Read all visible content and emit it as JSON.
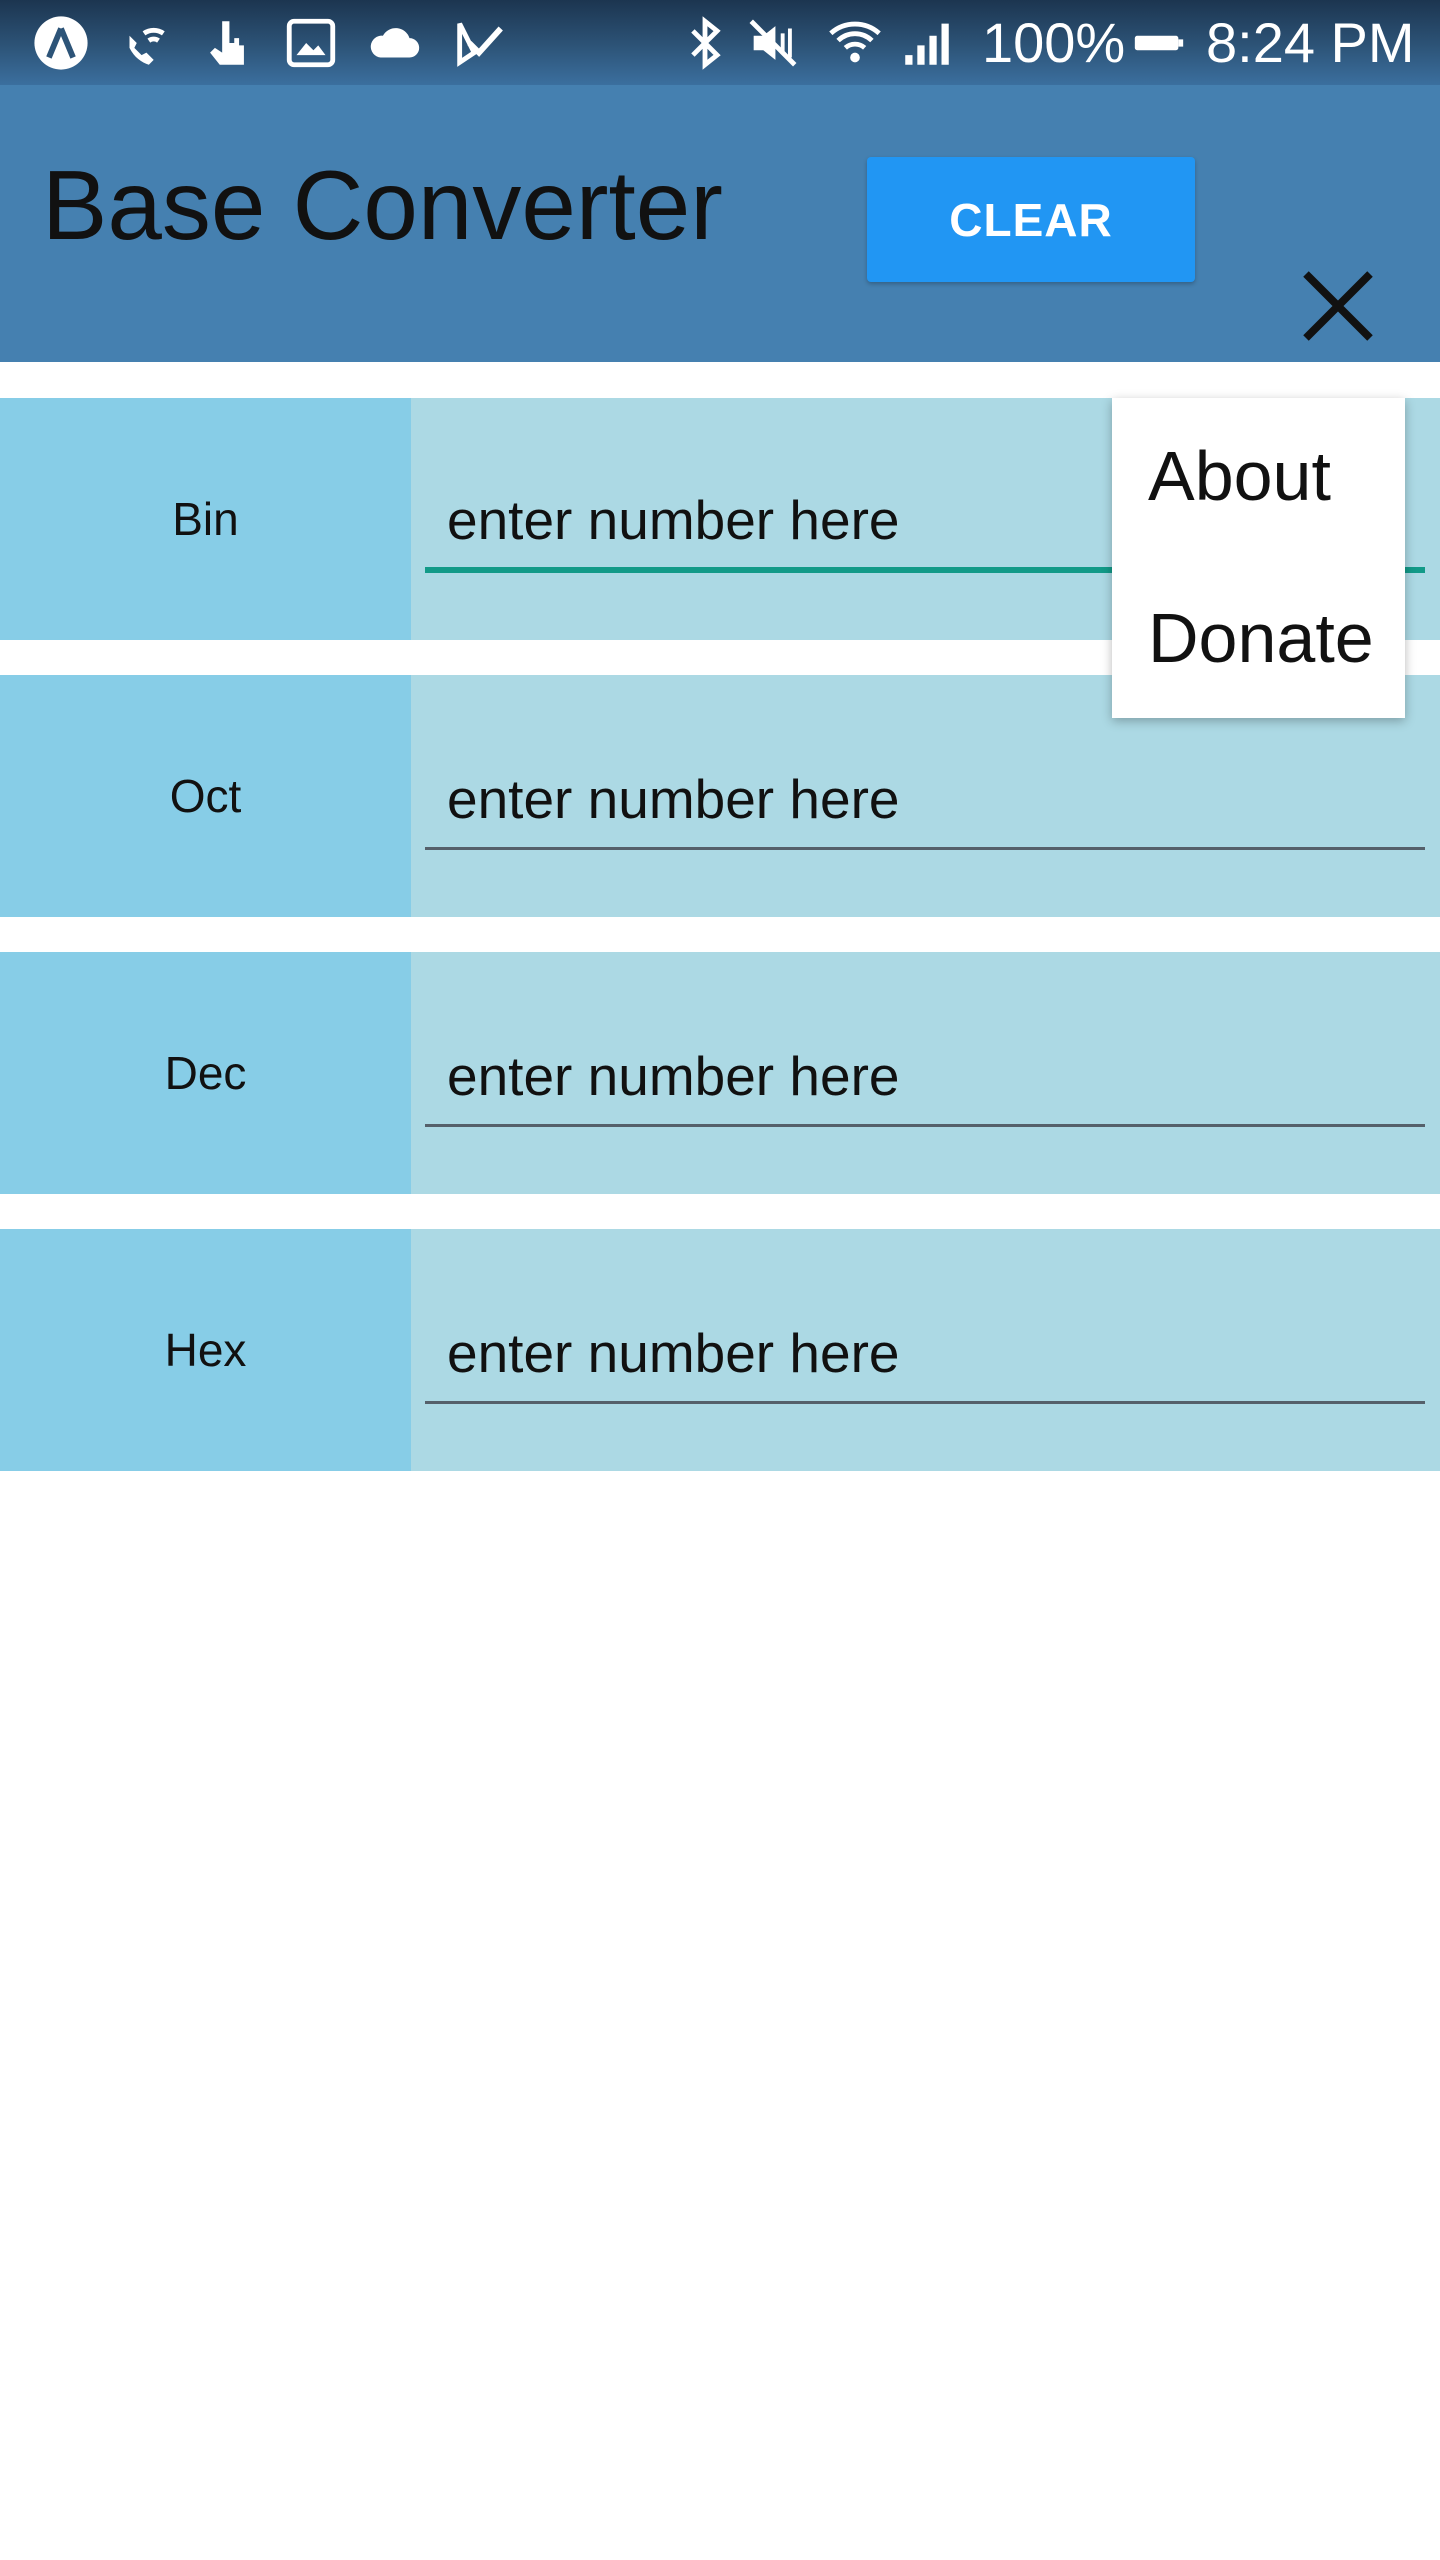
{
  "status_bar": {
    "battery": "100%",
    "time": "8:24 PM",
    "left_icons": [
      "app-icon",
      "wifi-call-icon",
      "touch-icon",
      "gallery-icon",
      "cloud-icon",
      "check-icon"
    ],
    "right_icons": [
      "bluetooth-icon",
      "mute-icon",
      "wifi-icon",
      "signal-icon",
      "battery-icon"
    ]
  },
  "app_bar": {
    "title": "Base Converter",
    "clear_label": "CLEAR",
    "close_icon": "close-icon"
  },
  "rows": [
    {
      "label": "Bin",
      "placeholder": "enter number here",
      "value": ""
    },
    {
      "label": "Oct",
      "placeholder": "enter number here",
      "value": ""
    },
    {
      "label": "Dec",
      "placeholder": "enter number here",
      "value": ""
    },
    {
      "label": "Hex",
      "placeholder": "enter number here",
      "value": ""
    }
  ],
  "menu": {
    "items": [
      {
        "label": "About"
      },
      {
        "label": "Donate"
      }
    ]
  },
  "colors": {
    "app_bar": "#4580b0",
    "clear_button": "#2196f3",
    "row_label_bg": "#87cde7",
    "row_input_bg": "#acd9e4",
    "focus_underline": "#129a88"
  }
}
